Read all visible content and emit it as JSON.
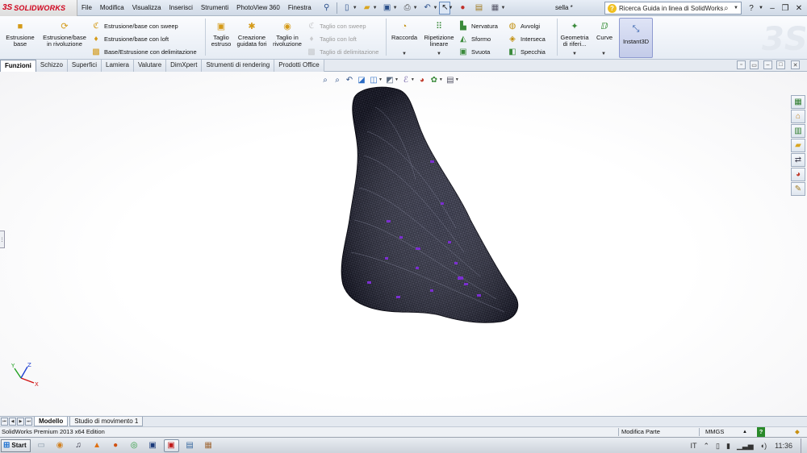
{
  "app": {
    "logo_prefix": "3S",
    "logo_text": "SOLIDWORKS",
    "document_title": "sella *"
  },
  "menu": [
    "File",
    "Modifica",
    "Visualizza",
    "Inserisci",
    "Strumenti",
    "PhotoView 360",
    "Finestra"
  ],
  "help_search": {
    "placeholder": "Ricerca Guida in linea di SolidWorks"
  },
  "ribbon": {
    "estrusione_base": "Estrusione base",
    "estrusione_rivoluzione": "Estrusione/base in rivoluzione",
    "estrusione_sweep": "Estrusione/base con sweep",
    "estrusione_loft": "Estrusione/base con loft",
    "base_delimitazione": "Base/Estrusione con delimitazione",
    "taglio_estruso": "Taglio estruso",
    "creazione_fori": "Creazione guidata fori",
    "taglio_rivoluzione": "Taglio in rivoluzione",
    "taglio_sweep": "Taglio con sweep",
    "taglio_loft": "Taglio con loft",
    "taglio_delimitazione": "Taglio di delimitazione",
    "raccorda": "Raccorda",
    "ripetizione_lineare": "Ripetizione lineare",
    "nervatura": "Nervatura",
    "sformo": "Sformo",
    "svuota": "Svuota",
    "avvolgi": "Avvolgi",
    "interseca": "Interseca",
    "specchia": "Specchia",
    "geometria": "Geometria di riferi...",
    "curve": "Curve",
    "instant3d": "Instant3D"
  },
  "tabs": [
    "Funzioni",
    "Schizzo",
    "Superfici",
    "Lamiera",
    "Valutare",
    "DimXpert",
    "Strumenti di rendering",
    "Prodotti Office"
  ],
  "bottom_tabs": [
    "Modello",
    "Studio di movimento 1"
  ],
  "status": {
    "edition": "SolidWorks Premium 2013 x64 Edition",
    "mode": "Modifica Parte",
    "units": "MMGS",
    "help": "?"
  },
  "taskbar": {
    "start": "Start",
    "lang": "IT",
    "time": "11:36"
  },
  "triad": {
    "x": "X",
    "y": "Y",
    "z": "Z"
  },
  "colors": {
    "accent": "#d0021b",
    "mesh": "#1a1a2e",
    "highlight": "#7b2fd0"
  }
}
